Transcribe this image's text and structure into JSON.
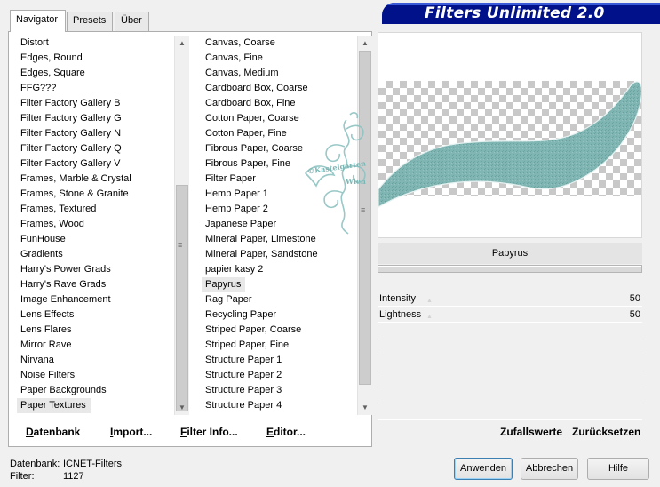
{
  "tabs": [
    {
      "label": "Navigator",
      "active": true
    },
    {
      "label": "Presets",
      "active": false
    },
    {
      "label": "Über",
      "active": false
    }
  ],
  "banner": {
    "title": "Filters Unlimited 2.0"
  },
  "categories": {
    "items": [
      "Distort",
      "Edges, Round",
      "Edges, Square",
      "FFG???",
      "Filter Factory Gallery B",
      "Filter Factory Gallery G",
      "Filter Factory Gallery N",
      "Filter Factory Gallery Q",
      "Filter Factory Gallery V",
      "Frames, Marble & Crystal",
      "Frames, Stone & Granite",
      "Frames, Textured",
      "Frames, Wood",
      "FunHouse",
      "Gradients",
      "Harry's Power Grads",
      "Harry's Rave Grads",
      "Image Enhancement",
      "Lens Effects",
      "Lens Flares",
      "Mirror Rave",
      "Nirvana",
      "Noise Filters",
      "Paper Backgrounds",
      "Paper Textures"
    ],
    "selected": "Paper Textures"
  },
  "filters": {
    "items": [
      "Canvas, Coarse",
      "Canvas, Fine",
      "Canvas, Medium",
      "Cardboard Box, Coarse",
      "Cardboard Box, Fine",
      "Cotton Paper, Coarse",
      "Cotton Paper, Fine",
      "Fibrous Paper, Coarse",
      "Fibrous Paper, Fine",
      "Filter Paper",
      "Hemp Paper 1",
      "Hemp Paper 2",
      "Japanese Paper",
      "Mineral Paper, Limestone",
      "Mineral Paper, Sandstone",
      "papier kasy 2",
      "Papyrus",
      "Rag Paper",
      "Recycling Paper",
      "Striped Paper, Coarse",
      "Striped Paper, Fine",
      "Structure Paper 1",
      "Structure Paper 2",
      "Structure Paper 3",
      "Structure Paper 4"
    ],
    "selected": "Papyrus"
  },
  "toolbar": {
    "datenbank": "Datenbank",
    "import": "Import...",
    "filterinfo": "Filter Info...",
    "editor": "Editor..."
  },
  "filter_name": "Papyrus",
  "params": [
    {
      "label": "Intensity",
      "value": "50"
    },
    {
      "label": "Lightness",
      "value": "50"
    }
  ],
  "right_toolbar": {
    "random": "Zufallswerte",
    "reset": "Zurücksetzen"
  },
  "status": {
    "db_label": "Datenbank:",
    "db_value": "ICNET-Filters",
    "filter_label": "Filter:",
    "filter_value": "1127"
  },
  "buttons": {
    "apply": "Anwenden",
    "cancel": "Abbrechen",
    "help": "Hilfe"
  },
  "watermark": {
    "line1": "©Kastelgarten",
    "line2": "Wien"
  },
  "colors": {
    "banner": "#00118a",
    "preview_shape": "#7fb5b3"
  }
}
